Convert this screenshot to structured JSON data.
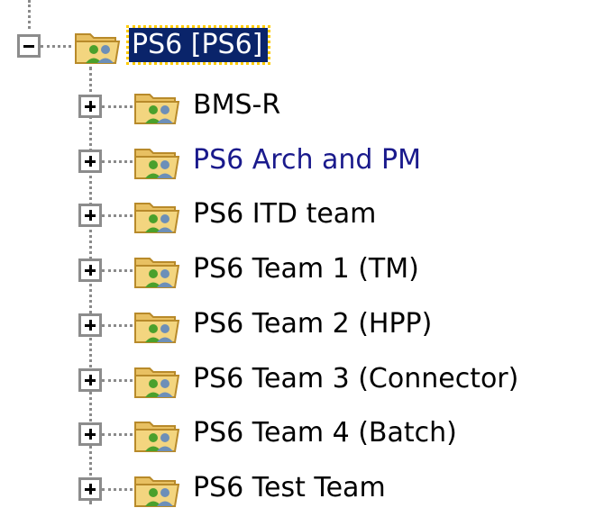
{
  "tree": {
    "root": {
      "label": "PS6 [PS6]",
      "expanded": true,
      "selected": true,
      "icon": "group-folder-icon"
    },
    "children": [
      {
        "label": "BMS-R",
        "expanded": false,
        "icon": "group-folder-icon"
      },
      {
        "label": "PS6 Arch and PM",
        "expanded": false,
        "icon": "group-folder-icon"
      },
      {
        "label": "PS6 ITD team",
        "expanded": false,
        "icon": "group-folder-icon"
      },
      {
        "label": "PS6 Team 1 (TM)",
        "expanded": false,
        "icon": "group-folder-icon"
      },
      {
        "label": "PS6 Team 2 (HPP)",
        "expanded": false,
        "icon": "group-folder-icon"
      },
      {
        "label": "PS6 Team 3 (Connector)",
        "expanded": false,
        "icon": "group-folder-icon"
      },
      {
        "label": "PS6 Team 4 (Batch)",
        "expanded": false,
        "icon": "group-folder-icon"
      },
      {
        "label": "PS6 Test Team",
        "expanded": false,
        "icon": "group-folder-icon"
      }
    ]
  },
  "colors": {
    "selection_bg": "#0a246a",
    "selection_text": "#ffffff",
    "focus_outline": "#ffcc00",
    "connector_line": "#8a8a8a",
    "label_text": "#000000",
    "folder_yellow": "#e8c062",
    "group_green": "#4aa02c",
    "group_blue": "#6d8fb8"
  }
}
